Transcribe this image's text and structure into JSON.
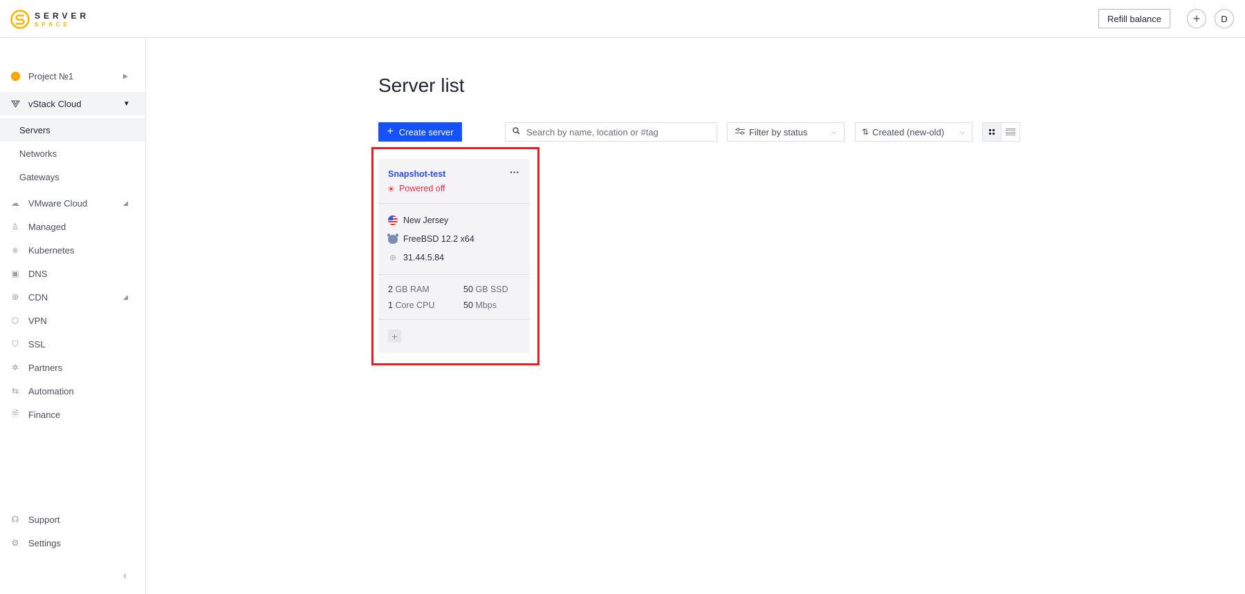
{
  "header": {
    "logo": {
      "line1": "SERVER",
      "line2": "SPACE"
    },
    "refill_label": "Refill balance",
    "add_label": "+",
    "avatar_initial": "D"
  },
  "sidebar": {
    "project": {
      "label": "Project №1",
      "icon": "project-dot-icon"
    },
    "section": {
      "label": "vStack Cloud",
      "icon": "vstack-icon",
      "expanded": true
    },
    "sub_items": [
      {
        "label": "Servers",
        "active": true
      },
      {
        "label": "Networks",
        "active": false
      },
      {
        "label": "Gateways",
        "active": false
      }
    ],
    "items": [
      {
        "label": "VMware Cloud",
        "icon": "cloud-icon",
        "has_arrow": true
      },
      {
        "label": "Managed",
        "icon": "managed-icon",
        "has_arrow": false
      },
      {
        "label": "Kubernetes",
        "icon": "kubernetes-icon",
        "has_arrow": false
      },
      {
        "label": "DNS",
        "icon": "dns-icon",
        "has_arrow": false
      },
      {
        "label": "CDN",
        "icon": "globe-icon",
        "has_arrow": true
      },
      {
        "label": "VPN",
        "icon": "vpn-icon",
        "has_arrow": false
      },
      {
        "label": "SSL",
        "icon": "shield-icon",
        "has_arrow": false
      },
      {
        "label": "Partners",
        "icon": "partners-icon",
        "has_arrow": false
      },
      {
        "label": "Automation",
        "icon": "arrows-icon",
        "has_arrow": false
      },
      {
        "label": "Finance",
        "icon": "document-icon",
        "has_arrow": false
      }
    ],
    "bottom_items": [
      {
        "label": "Support",
        "icon": "headset-icon"
      },
      {
        "label": "Settings",
        "icon": "gear-icon"
      }
    ]
  },
  "main": {
    "title": "Server list",
    "create_label": "Create server",
    "search": {
      "placeholder": "Search by name, location or #tag",
      "value": ""
    },
    "filter": {
      "label": "Filter by status"
    },
    "sort": {
      "label": "Created (new-old)"
    },
    "view_mode": "grid"
  },
  "servers": [
    {
      "name": "Snapshot-test",
      "status": "Powered off",
      "status_color": "#ee2a4b",
      "location": "New Jersey",
      "os": "FreeBSD 12.2 x64",
      "ip": "31.44.5.84",
      "ram": {
        "value": "2",
        "unit": "GB RAM"
      },
      "disk": {
        "value": "50",
        "unit": "GB SSD"
      },
      "cpu": {
        "value": "1",
        "unit": "Core CPU"
      },
      "bandwidth": {
        "value": "50",
        "unit": "Mbps"
      }
    }
  ],
  "colors": {
    "accent": "#1552ff",
    "highlight": "#e21d26",
    "logo": "#f7b500"
  }
}
